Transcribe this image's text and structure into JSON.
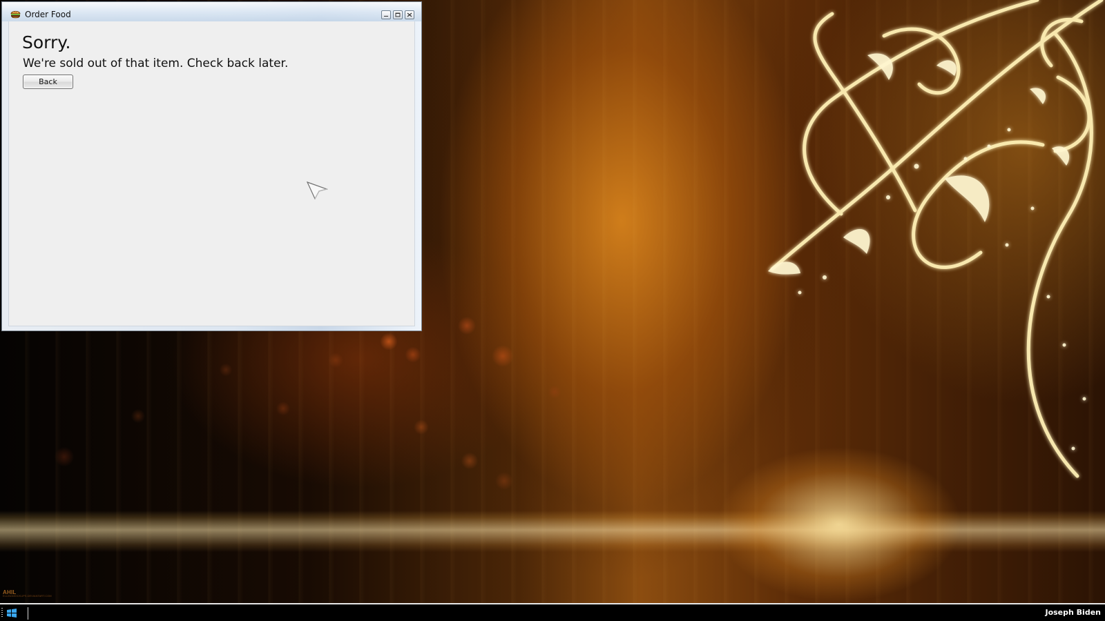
{
  "window": {
    "title": "Order Food",
    "icon": "burger-icon",
    "controls": [
      "minimize-icon",
      "maximize-icon",
      "close-icon"
    ]
  },
  "content": {
    "heading": "Sorry.",
    "message": "We're sold out of that item. Check back later.",
    "back_button": "Back"
  },
  "desktop": {
    "watermark_mark": "AHIL",
    "watermark_site": "ELLINGMOCKUPS.DEVIANTART.COM",
    "accent_colors": [
      "#f4b63b",
      "#ffdf8a",
      "#8c4d10",
      "#000000"
    ]
  },
  "taskbar": {
    "start_icon": "windows-start-icon",
    "user_name": "Joseph Biden"
  }
}
